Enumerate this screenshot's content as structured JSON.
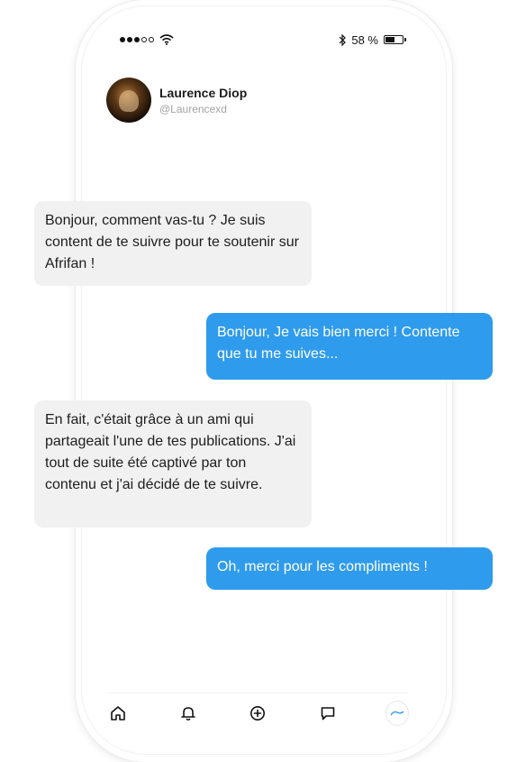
{
  "status_bar": {
    "battery_text": "58 %",
    "battery_level": 0.58,
    "signal_bars": 3,
    "signal_total": 5
  },
  "contact": {
    "name": "Laurence Diop",
    "handle": "@Laurencexd"
  },
  "messages": [
    {
      "direction": "incoming",
      "text": "Bonjour, comment vas-tu ? Je suis content de te suivre pour te soutenir sur Afrifan !"
    },
    {
      "direction": "outgoing",
      "text": "Bonjour, Je vais bien merci ! Contente que tu me suives..."
    },
    {
      "direction": "incoming",
      "text": "En fait, c'était grâce à un ami qui partageait l'une de tes publications. J'ai tout de suite été captivé par ton contenu et j'ai décidé de te suivre."
    },
    {
      "direction": "outgoing",
      "text": "Oh, merci pour les compliments !"
    }
  ],
  "bottom_nav": {
    "items": [
      "home-icon",
      "bell-icon",
      "add-circle-icon",
      "chat-icon",
      "profile-avatar"
    ]
  },
  "colors": {
    "accent": "#2f9bec",
    "incoming_bubble": "#f1f1f1"
  }
}
